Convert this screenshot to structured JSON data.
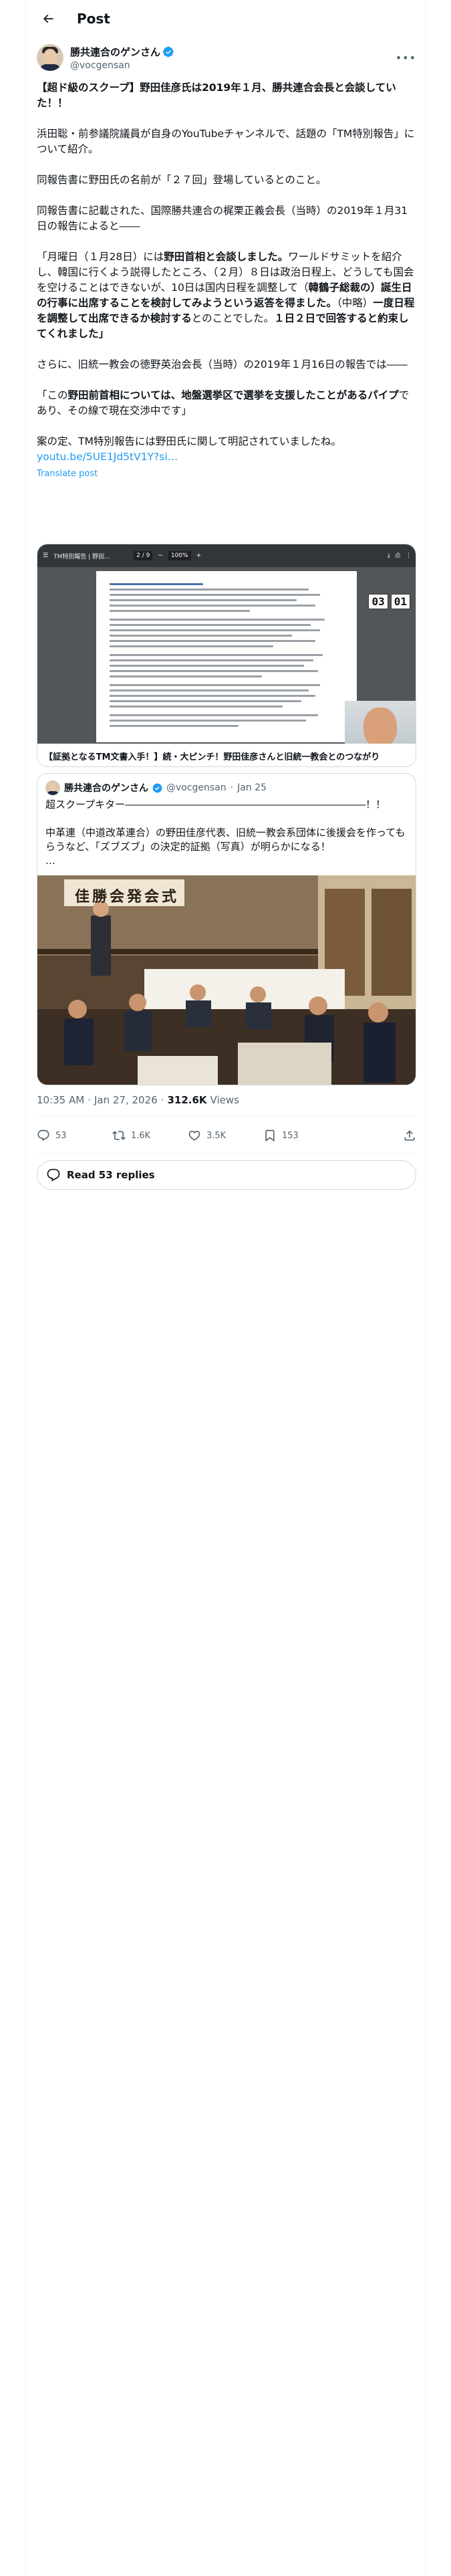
{
  "topbar": {
    "title": "Post",
    "back_icon": "back-arrow-icon"
  },
  "author": {
    "name": "勝共連合のゲンさん",
    "handle": "@vocgensan",
    "verified_color": "#1d9bf0",
    "more_icon": "more-icon"
  },
  "post": {
    "para1_bold": "【超ド級のスクープ】野田佳彦氏は2019年１月、勝共連合会長と会談していた！！",
    "para2": "浜田聡・前参議院議員が自身のYouTubeチャンネルで、話題の「TM特別報告」について紹介。",
    "para3": "同報告書に野田氏の名前が「２７回」登場しているとのこと。",
    "para4": "同報告書に記載された、国際勝共連合の梶栗正義会長（当時）の2019年１月31日の報告によると――",
    "para5_a": "「月曜日（１月28日）には",
    "para5_b": "野田首相と会談しました。",
    "para5_c": "ワールドサミットを紹介し、韓国に行くよう説得したところ、（２月）８日は政治日程上、どうしても国会を空けることはできないが、10日は国内日程を調整して（",
    "para5_d": "韓鶴子総裁の）誕生日の行事に出席することを検討してみようという返答を得ました。",
    "para5_e": "（中略）",
    "para5_f": "一度日程を調整して出席できるか検討する",
    "para5_g": "とのことでした。",
    "para5_h": "１日２日で回答すると約束してくれました」",
    "para6": "さらに、旧統一教会の徳野英治会長（当時）の2019年１月16日の報告では――",
    "para7_a": "「この",
    "para7_b": "野田前首相については、地盤選挙区で選挙を支援したことがある",
    "para7_c": "パイプ",
    "para7_d": "であり、その線で現在交渉中です」",
    "para8": "案の定、TM特別報告には野田氏に関して明記されていましたね。",
    "link": "youtu.be/5UE1Jd5tV1Y?si…",
    "translate": "Translate post"
  },
  "media": {
    "pdf_title": "TM特別報告 | 野田...",
    "page_indicator": "2 / 9",
    "zoom": "100%",
    "timer_min": "03",
    "timer_sec": "01",
    "caption": "【証拠となるTM文書入手！】続・大ピンチ！野田佳彦さんと旧統一教会とのつながり"
  },
  "quote": {
    "name": "勝共連合のゲンさん",
    "handle": "@vocgensan",
    "date": "Jan 25",
    "text": "超スクープキター――――――――――――――――――――――――！！\n\n中革連（中道改革連合）の野田佳彦代表、旧統一教会系団体に後援会を作ってもらうなど、「ズブズブ」の決定的証拠（写真）が明らかになる！\n…",
    "photo_banner": "佳勝会発会式"
  },
  "meta": {
    "time": "10:35 AM",
    "date": "Jan 27, 2026",
    "views_num": "312.6K",
    "views_label": "Views"
  },
  "actions": {
    "replies": "53",
    "reposts": "1.6K",
    "likes": "3.5K",
    "bookmarks": "153"
  },
  "read_replies": "Read 53 replies",
  "colors": {
    "accent": "#1d9bf0",
    "text": "#0f1419",
    "secondary": "#536471",
    "border": "#cfd9de"
  }
}
